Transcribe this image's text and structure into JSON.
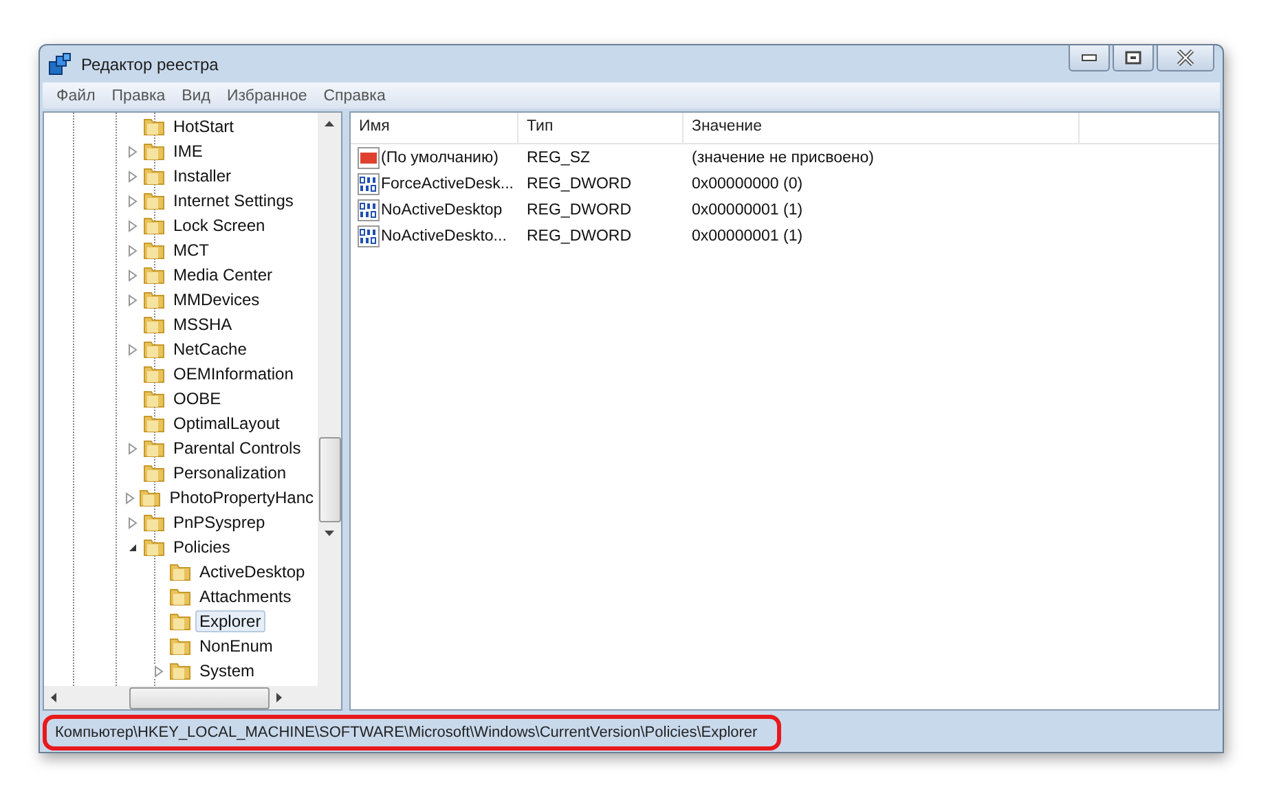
{
  "window": {
    "title": "Редактор реестра"
  },
  "menu": [
    "Файл",
    "Правка",
    "Вид",
    "Избранное",
    "Справка"
  ],
  "tree": [
    {
      "label": "HotStart",
      "expandable": false,
      "selected": false
    },
    {
      "label": "IME",
      "expandable": true,
      "selected": false
    },
    {
      "label": "Installer",
      "expandable": true,
      "selected": false
    },
    {
      "label": "Internet Settings",
      "expandable": true,
      "selected": false
    },
    {
      "label": "Lock Screen",
      "expandable": true,
      "selected": false
    },
    {
      "label": "MCT",
      "expandable": true,
      "selected": false
    },
    {
      "label": "Media Center",
      "expandable": true,
      "selected": false
    },
    {
      "label": "MMDevices",
      "expandable": true,
      "selected": false
    },
    {
      "label": "MSSHA",
      "expandable": false,
      "selected": false
    },
    {
      "label": "NetCache",
      "expandable": true,
      "selected": false
    },
    {
      "label": "OEMInformation",
      "expandable": false,
      "selected": false
    },
    {
      "label": "OOBE",
      "expandable": false,
      "selected": false
    },
    {
      "label": "OptimalLayout",
      "expandable": false,
      "selected": false
    },
    {
      "label": "Parental Controls",
      "expandable": true,
      "selected": false
    },
    {
      "label": "Personalization",
      "expandable": false,
      "selected": false
    },
    {
      "label": "PhotoPropertyHanc",
      "expandable": true,
      "selected": false
    },
    {
      "label": "PnPSysprep",
      "expandable": true,
      "selected": false
    },
    {
      "label": "Policies",
      "expandable": true,
      "expanded": true,
      "selected": false,
      "children": [
        {
          "label": "ActiveDesktop",
          "expandable": false,
          "selected": false
        },
        {
          "label": "Attachments",
          "expandable": false,
          "selected": false
        },
        {
          "label": "Explorer",
          "expandable": false,
          "selected": true
        },
        {
          "label": "NonEnum",
          "expandable": false,
          "selected": false
        },
        {
          "label": "System",
          "expandable": true,
          "selected": false
        }
      ]
    }
  ],
  "table": {
    "columns": [
      "Имя",
      "Тип",
      "Значение"
    ],
    "rows": [
      {
        "kind": "string",
        "name": "(По умолчанию)",
        "type": "REG_SZ",
        "value": "(значение не присвоено)"
      },
      {
        "kind": "binary",
        "name": "ForceActiveDesk...",
        "type": "REG_DWORD",
        "value": "0x00000000 (0)"
      },
      {
        "kind": "binary",
        "name": "NoActiveDesktop",
        "type": "REG_DWORD",
        "value": "0x00000001 (1)"
      },
      {
        "kind": "binary",
        "name": "NoActiveDeskto...",
        "type": "REG_DWORD",
        "value": "0x00000001 (1)"
      }
    ]
  },
  "status_bar": {
    "path": "Компьютер\\HKEY_LOCAL_MACHINE\\SOFTWARE\\Microsoft\\Windows\\CurrentVersion\\Policies\\Explorer",
    "highlighted": true
  }
}
